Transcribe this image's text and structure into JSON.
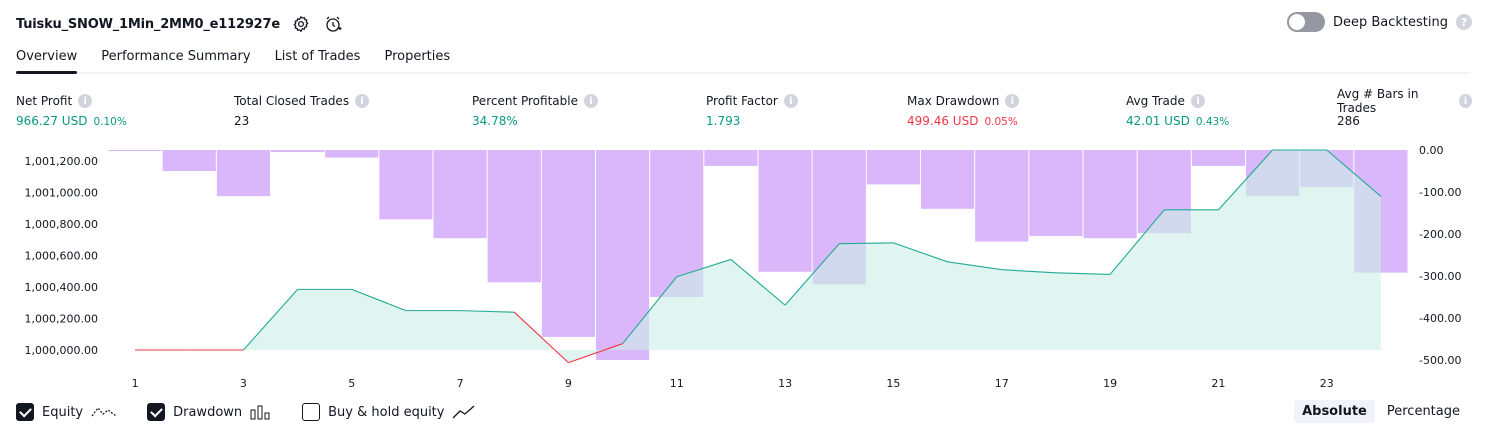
{
  "strategy": {
    "title": "Tuisku_SNOW_1Min_2MM0_e112927e"
  },
  "deep_backtesting": {
    "label": "Deep Backtesting",
    "enabled": false,
    "help": "?"
  },
  "tabs": [
    {
      "label": "Overview",
      "active": true
    },
    {
      "label": "Performance Summary",
      "active": false
    },
    {
      "label": "List of Trades",
      "active": false
    },
    {
      "label": "Properties",
      "active": false
    }
  ],
  "metrics": [
    {
      "label": "Net Profit",
      "value": "966.27 USD",
      "pct": "0.10%",
      "color": "green"
    },
    {
      "label": "Total Closed Trades",
      "value": "23",
      "pct": "",
      "color": "dark"
    },
    {
      "label": "Percent Profitable",
      "value": "34.78%",
      "pct": "",
      "color": "green"
    },
    {
      "label": "Profit Factor",
      "value": "1.793",
      "pct": "",
      "color": "green"
    },
    {
      "label": "Max Drawdown",
      "value": "499.46 USD",
      "pct": "0.05%",
      "color": "red"
    },
    {
      "label": "Avg Trade",
      "value": "42.01 USD",
      "pct": "0.43%",
      "color": "green"
    },
    {
      "label": "Avg # Bars in Trades",
      "value": "286",
      "pct": "",
      "color": "dark"
    }
  ],
  "chart_data": {
    "type": "area",
    "x_ticks": [
      "1",
      "3",
      "5",
      "7",
      "9",
      "11",
      "13",
      "15",
      "17",
      "19",
      "21",
      "23"
    ],
    "y_left_ticks": [
      "1,001,200.00",
      "1,001,000.00",
      "1,000,800.00",
      "1,000,600.00",
      "1,000,400.00",
      "1,000,200.00",
      "1,000,000.00"
    ],
    "y_right_ticks": [
      "0.00",
      "-100.00",
      "-200.00",
      "-300.00",
      "-400.00",
      "-500.00"
    ],
    "y_left_range": [
      1000000,
      1001270
    ],
    "y_right_range": [
      -500,
      0
    ],
    "equity": {
      "x": [
        1,
        2,
        3,
        4,
        5,
        6,
        7,
        8,
        9,
        10,
        11,
        12,
        13,
        14,
        15,
        16,
        17,
        18,
        19,
        20,
        21,
        22,
        23,
        24
      ],
      "values": [
        1000000,
        1000000,
        1000000,
        1000385,
        1000385,
        1000250,
        1000250,
        1000240,
        999920,
        1000040,
        1000465,
        1000575,
        1000285,
        1000675,
        1000680,
        1000560,
        1000510,
        1000490,
        1000480,
        1000890,
        1000890,
        1001270,
        1001270,
        1000975
      ],
      "color": "#22ab94",
      "fill": "#cdeee6",
      "negative_color": "#f23645"
    },
    "drawdown": {
      "x": [
        1,
        2,
        3,
        4,
        5,
        6,
        7,
        8,
        9,
        10,
        11,
        12,
        13,
        14,
        15,
        16,
        17,
        18,
        19,
        20,
        21,
        22,
        23,
        24
      ],
      "values": [
        0,
        -50,
        -110,
        -5,
        -18,
        -165,
        -210,
        -315,
        -445,
        -500,
        -350,
        -38,
        -290,
        -320,
        -82,
        -140,
        -218,
        -205,
        -210,
        -198,
        -38,
        -110,
        -88,
        -292
      ],
      "color": "#d9b7fa"
    }
  },
  "legend": [
    {
      "label": "Equity",
      "checked": true,
      "icon": "equity-line-icon"
    },
    {
      "label": "Drawdown",
      "checked": true,
      "icon": "drawdown-bars-icon"
    },
    {
      "label": "Buy & hold equity",
      "checked": false,
      "icon": "buyhold-line-icon"
    }
  ],
  "modes": [
    {
      "label": "Absolute",
      "active": true
    },
    {
      "label": "Percentage",
      "active": false
    }
  ]
}
